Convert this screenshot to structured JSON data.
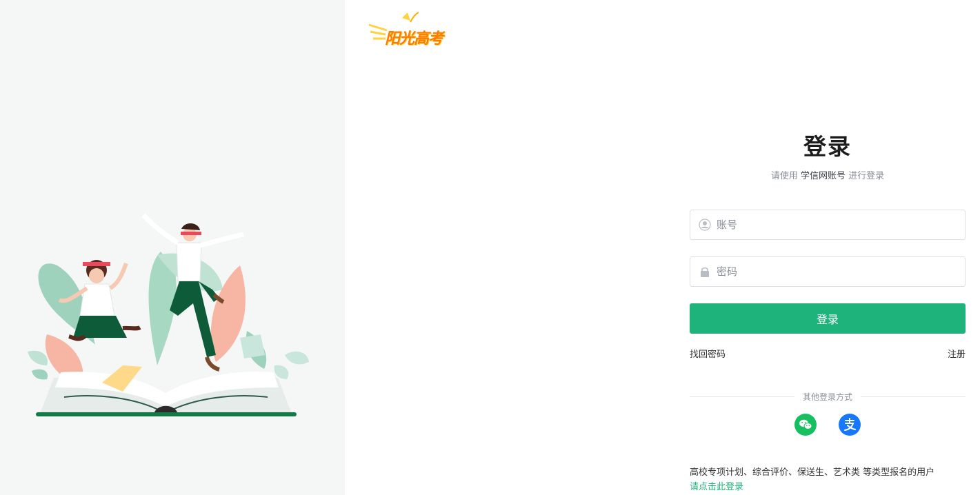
{
  "brand": {
    "logo_text": "阳光高考"
  },
  "login": {
    "title": "登录",
    "subtitle_prefix": "请使用",
    "subtitle_emphasis": "学信网账号",
    "subtitle_suffix": "进行登录",
    "account_placeholder": "账号",
    "password_placeholder": "密码",
    "submit_label": "登录",
    "forgot_password": "找回密码",
    "register": "注册",
    "other_methods": "其他登录方式"
  },
  "social": [
    {
      "name": "wechat",
      "icon": "wechat-icon",
      "color": "#16c060"
    },
    {
      "name": "alipay",
      "icon": "alipay-icon",
      "color": "#1677ff"
    }
  ],
  "notice": {
    "text": "高校专项计划、综合评价、保送生、艺术类 等类型报名的用户",
    "link": "请点击此登录"
  },
  "colors": {
    "accent": "#1db37a",
    "left_panel_bg": "#f5f7f6",
    "logo_orange": "#ff7a00"
  }
}
